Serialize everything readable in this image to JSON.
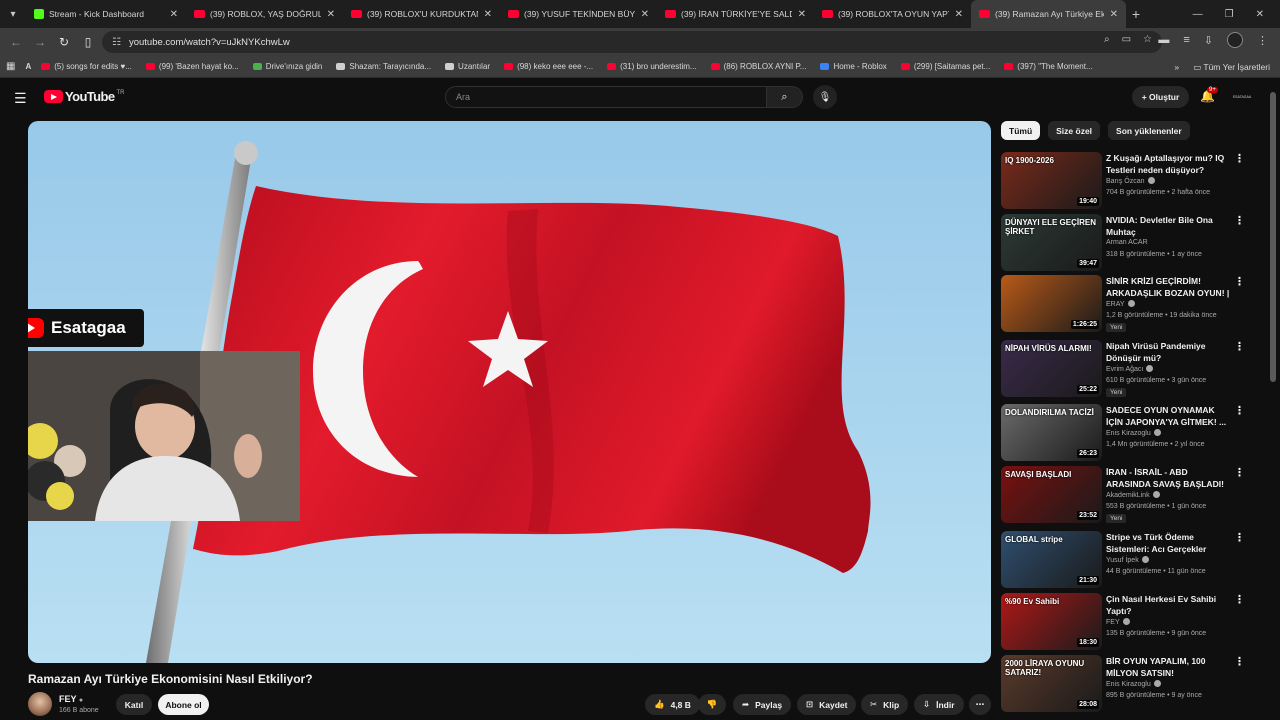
{
  "browser": {
    "tabs": [
      {
        "label": "Stream - Kick Dashboard",
        "kind": "kick"
      },
      {
        "label": "(39) ROBLOX, YAŞ DOĞRULAM...",
        "kind": "yt"
      },
      {
        "label": "(39) ROBLOX'U KURDUKTAN S...",
        "kind": "yt"
      },
      {
        "label": "(39) YUSUF TEKİNDEN BÜYÜK ...",
        "kind": "yt"
      },
      {
        "label": "(39) İRAN TÜRKİYE'YE SALDIRA...",
        "kind": "yt"
      },
      {
        "label": "(39) ROBLOX'TA OYUN YAPTIĞ...",
        "kind": "yt"
      },
      {
        "label": "(39) Ramazan Ayı Türkiye Ekon...",
        "kind": "yt",
        "active": true
      }
    ],
    "url": "youtube.com/watch?v=uJkNYKchwLw",
    "bookmarks": [
      {
        "label": "(5) songs for edits ♥...",
        "fav": "yt"
      },
      {
        "label": "(99) 'Bazen hayat ko...",
        "fav": "yt"
      },
      {
        "label": "Drive'ınıza gidin",
        "fav": "g"
      },
      {
        "label": "Shazam: Tarayıcında...",
        "fav": "w"
      },
      {
        "label": "Uzantılar",
        "fav": "w"
      },
      {
        "label": "(98) keko eee eee -...",
        "fav": "yt"
      },
      {
        "label": "(31) bro underestim...",
        "fav": "yt"
      },
      {
        "label": "(86) ROBLOX AYNI P...",
        "fav": "yt"
      },
      {
        "label": "Home - Roblox",
        "fav": "b"
      },
      {
        "label": "(299) [Saitamas pet...",
        "fav": "yt"
      },
      {
        "label": "(397) \"The Moment...",
        "fav": "yt"
      }
    ],
    "all_bookmarks": "Tüm Yer İşaretleri"
  },
  "header": {
    "logo": "YouTube",
    "country": "TR",
    "search_placeholder": "Ara",
    "create": "Oluştur",
    "notif_count": "9+",
    "avatar_text": "ESATAGAA"
  },
  "video": {
    "streamer_name": "Esatagaa",
    "title": "Ramazan Ayı Türkiye Ekonomisini Nasıl Etkiliyor?",
    "channel": "FEY",
    "subscribers": "166 B abone",
    "join": "Katıl",
    "subscribe": "Abone ol",
    "likes": "4,8 B",
    "share": "Paylaş",
    "save": "Kaydet",
    "clip": "Klip",
    "download": "İndir"
  },
  "sidebar": {
    "chips": [
      {
        "label": "Tümü",
        "active": true
      },
      {
        "label": "Size özel"
      },
      {
        "label": "Son yüklenenler"
      }
    ],
    "recommendations": [
      {
        "title": "Z Kuşağı Aptallaşıyor mu? IQ Testleri neden düşüyor?",
        "channel": "Barış Özcan",
        "verified": true,
        "meta": "704 B görüntüleme • 2 hafta önce",
        "duration": "19:40",
        "color": "#7a2a1a",
        "thumb_text": "IQ 1900-2026",
        "new": ""
      },
      {
        "title": "NVIDIA: Devletler Bile Ona Muhtaç",
        "channel": "Arman ACAR",
        "verified": false,
        "meta": "318 B görüntüleme • 1 ay önce",
        "duration": "39:47",
        "color": "#2c3a36",
        "thumb_text": "DÜNYAYI ELE GEÇİREN ŞİRKET",
        "new": ""
      },
      {
        "title": "SİNİR KRİZİ GEÇİRDİM! ARKADAŞLIK BOZAN OYUN! | ...",
        "channel": "ERAY",
        "verified": true,
        "meta": "1,2 B görüntüleme • 19 dakika önce",
        "duration": "1:26:25",
        "color": "#b85a18",
        "thumb_text": "",
        "new": "Yeni"
      },
      {
        "title": "Nipah Virüsü Pandemiye Dönüşür mü?",
        "channel": "Evrim Ağacı",
        "verified": true,
        "meta": "610 B görüntüleme • 3 gün önce",
        "duration": "25:22",
        "color": "#3a2a4a",
        "thumb_text": "NİPAH VİRÜS ALARMI!",
        "new": "Yeni"
      },
      {
        "title": "SADECE OYUN OYNAMAK İÇİN JAPONYA'YA GİTMEK! ...",
        "channel": "Enis Kirazoglu",
        "verified": true,
        "meta": "1,4 Mn görüntüleme • 2 yıl önce",
        "duration": "26:23",
        "color": "#6a6a6a",
        "thumb_text": "DOLANDIRILMA TACİZİ",
        "new": ""
      },
      {
        "title": "İRAN - İSRAİL - ABD ARASINDA SAVAŞ BAŞLADI! 🔥 | Savaşı, ...",
        "channel": "AkademikLink",
        "verified": true,
        "meta": "553 B görüntüleme • 1 gün önce",
        "duration": "23:52",
        "color": "#7a1010",
        "thumb_text": "SAVAŞI BAŞLADI",
        "new": "Yeni"
      },
      {
        "title": "Stripe vs Türk Ödeme Sistemleri: Acı Gerçekler",
        "channel": "Yusuf İpek",
        "verified": true,
        "meta": "44 B görüntüleme • 11 gün önce",
        "duration": "21:30",
        "color": "#2f4f6f",
        "thumb_text": "GLOBAL stripe",
        "new": ""
      },
      {
        "title": "Çin Nasıl Herkesi Ev Sahibi Yaptı?",
        "channel": "FEY",
        "verified": true,
        "meta": "135 B görüntüleme • 9 gün önce",
        "duration": "18:30",
        "color": "#b01818",
        "thumb_text": "%90 Ev Sahibi",
        "new": ""
      },
      {
        "title": "BİR OYUN YAPALIM, 100 MİLYON SATSIN! (İNSANLARA...",
        "channel": "Enis Kirazoglu",
        "verified": true,
        "meta": "895 B görüntüleme • 9 ay önce",
        "duration": "28:08",
        "color": "#5a3a2a",
        "thumb_text": "2000 LİRAYA OYUNU SATARIZ!",
        "new": ""
      }
    ]
  }
}
